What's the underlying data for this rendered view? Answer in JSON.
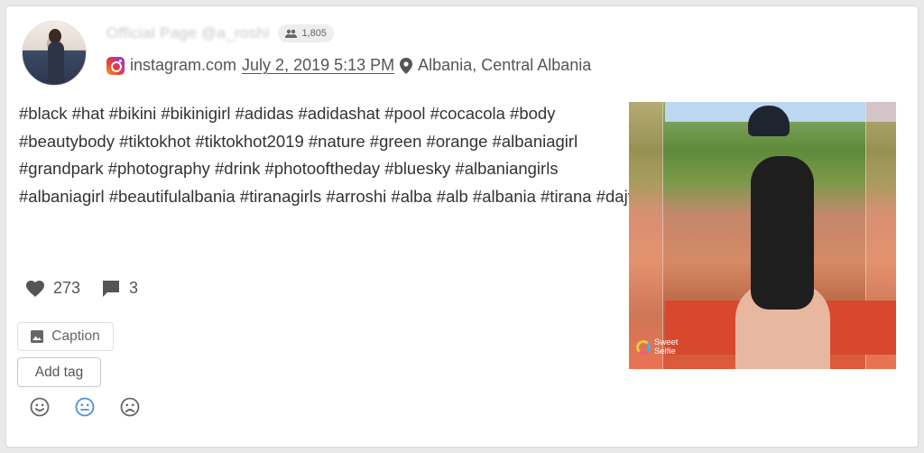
{
  "post": {
    "account_name": "Official Page",
    "handle": "@a_roshi",
    "followers": "1,805",
    "source": "instagram.com",
    "date": "July 2, 2019 5:13 PM",
    "location": "Albania, Central Albania",
    "caption": "#black #hat #bikini #bikinigirl #adidas #adidashat #pool #cocacola #body #beautybody #tiktokhot #tiktokhot2019 #nature #green #orange #albaniagirl #grandpark #photography #drink #photooftheday #bluesky #albaniangirls #albaniagirl #beautifulalbania #tiranagirls #arroshi #alba #alb #albania #tirana #dajt",
    "likes": "273",
    "comments": "3",
    "image_watermark": "Sweet Selfie"
  },
  "actions": {
    "caption_label": "Caption",
    "add_tag_label": "Add tag"
  },
  "sentiment": {
    "options": [
      "positive",
      "neutral",
      "negative"
    ],
    "selected": "neutral",
    "selected_color": "#4a90d9"
  },
  "colors": {
    "text": "#333333",
    "muted": "#666666",
    "border": "#d9d9d9"
  }
}
